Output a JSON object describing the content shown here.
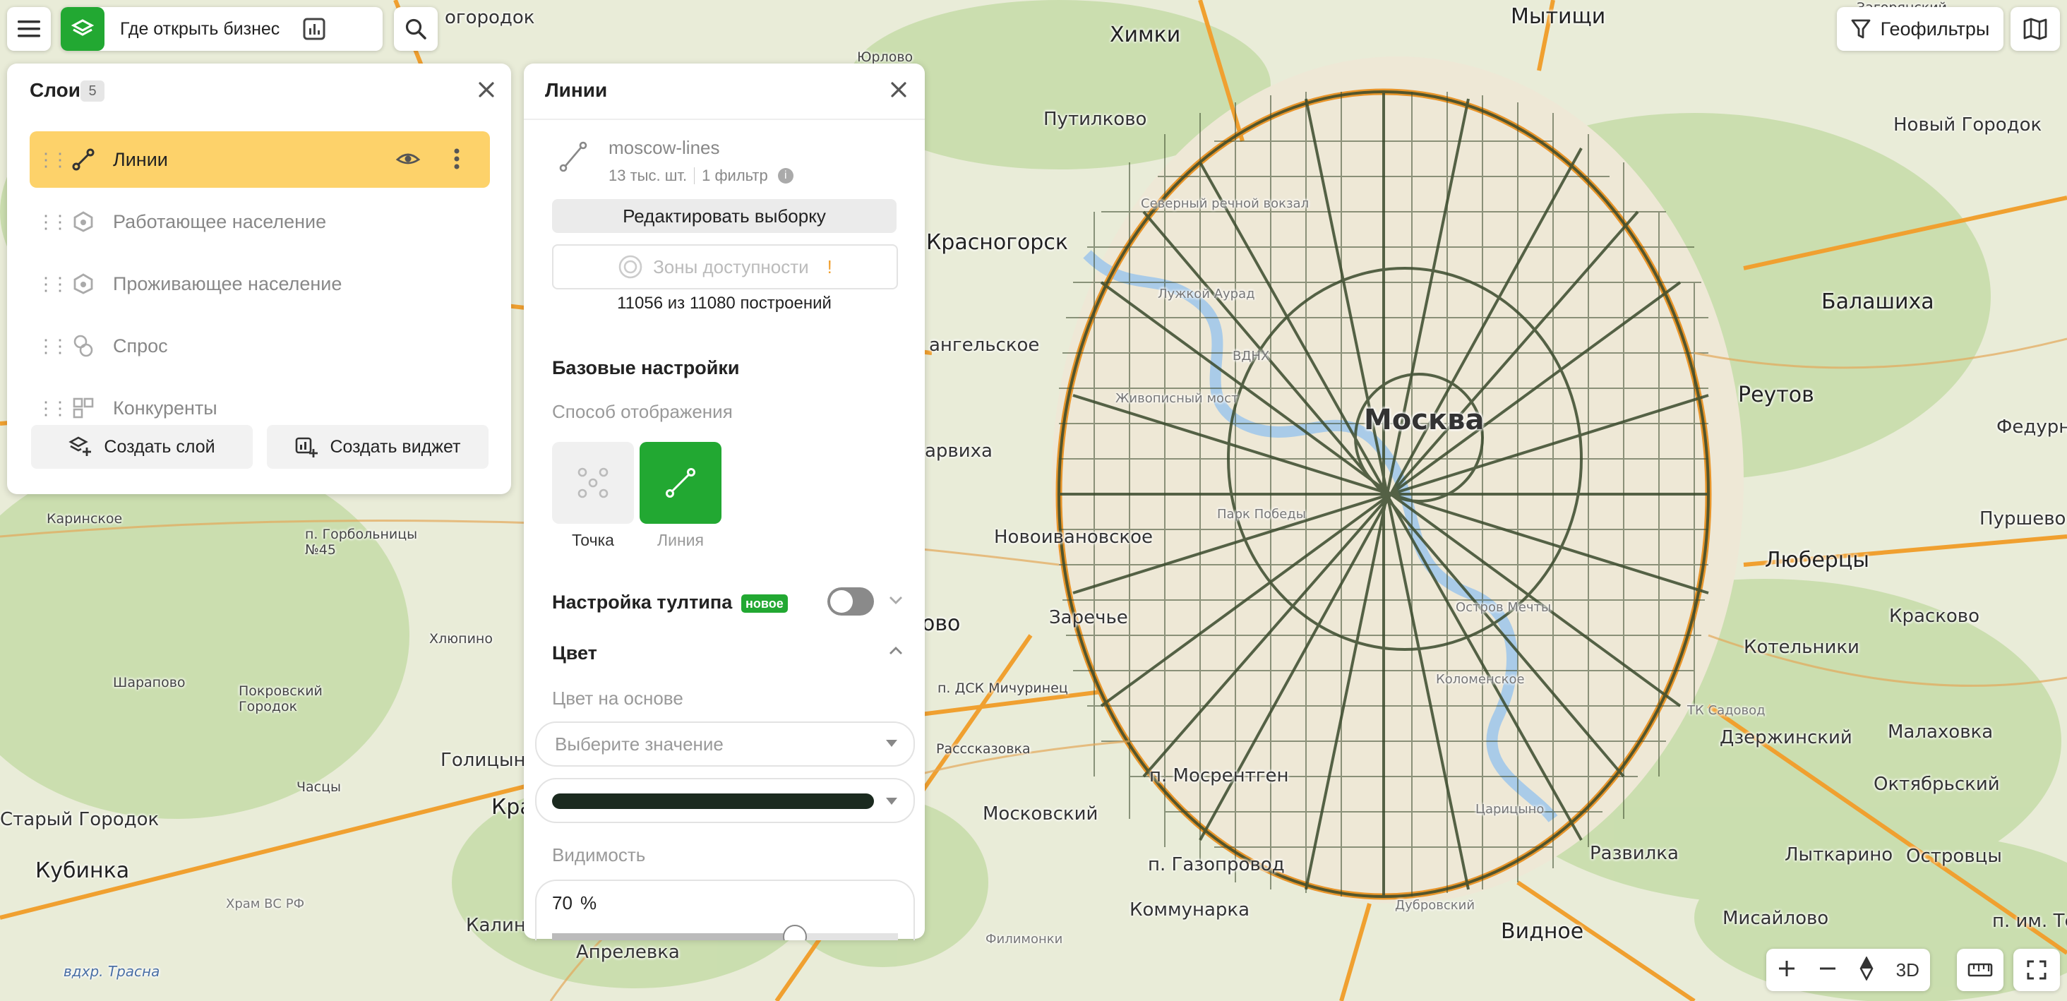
{
  "topbar": {
    "project_name": "Где открыть бизнес",
    "geofilters_label": "Геофильтры"
  },
  "layers_panel": {
    "title": "Слои",
    "count": "5",
    "items": [
      {
        "label": "Линии",
        "icon": "line-icon"
      },
      {
        "label": "Работающее население",
        "icon": "gauge-icon"
      },
      {
        "label": "Проживающее население",
        "icon": "gauge-icon"
      },
      {
        "label": "Спрос",
        "icon": "circles-icon"
      },
      {
        "label": "Конкуренты",
        "icon": "grid-icon"
      }
    ],
    "create_layer": "Создать слой",
    "create_widget": "Создать виджет"
  },
  "detail_panel": {
    "title": "Линии",
    "dataset_name": "moscow-lines",
    "dataset_count": "13 тыс. шт.",
    "dataset_filters": "1 фильтр",
    "edit_selection": "Редактировать выборку",
    "zones_label": "Зоны доступности",
    "zones_warning": "!",
    "buildings_status": "11056 из 11080 построений",
    "base_settings": "Базовые настройки",
    "display_mode_label": "Способ отображения",
    "display_modes": [
      {
        "label": "Точка",
        "selected": false
      },
      {
        "label": "Линия",
        "selected": true
      }
    ],
    "tooltip_settings": "Настройка тултипа",
    "new_badge": "новое",
    "color_section": "Цвет",
    "color_based_on": "Цвет на основе",
    "color_select_placeholder": "Выберите значение",
    "line_color": "#1b2a1f",
    "visibility_label": "Видимость",
    "visibility_value": "70",
    "visibility_unit": "%",
    "visibility_fraction": 0.7
  },
  "map": {
    "labels": [
      "огородок",
      "Химки",
      "Мытищи",
      "Юрлово",
      "Загорянский",
      "Путилково",
      "Новый Городок",
      "Северный речной вокзал",
      "Красногорск",
      "Балашиха",
      "Лужкой Аурад",
      "Реутов",
      "ангельское",
      "ВДНХ",
      "Федурно",
      "Живописный мост",
      "Москва",
      "арвиха",
      "Пуршево",
      "Парк Победы",
      "Новоивановское",
      "Люберцы",
      "Каринское",
      "п. Горбольницы №45",
      "Заречье",
      "Красково",
      "Хлюпино",
      "Остров Мечты",
      "Котельники",
      "Шарапово",
      "Покровский Городок",
      "п. ДСК Мичуринец",
      "Коломенское",
      "ТК Садовод",
      "Малаховка",
      "Дзержинский",
      "Расссказовка",
      "Голицыно",
      "Часцы",
      "п. Мосрентген",
      "Октябрьский",
      "Старый Городок",
      "Московский",
      "Лыткарино",
      "Островцы",
      "Кубинка",
      "Храм ВС РФ",
      "п. Газопровод",
      "Развилка",
      "Коммунарка",
      "Дубровский",
      "Мисайлово",
      "п. им. Тельм",
      "Калинине",
      "Апрелевка",
      "Филимонки",
      "Видное",
      "вдхр. Трасна",
      "Царицыно",
      "ово",
      "Кра"
    ],
    "zoom_3d": "3D"
  }
}
